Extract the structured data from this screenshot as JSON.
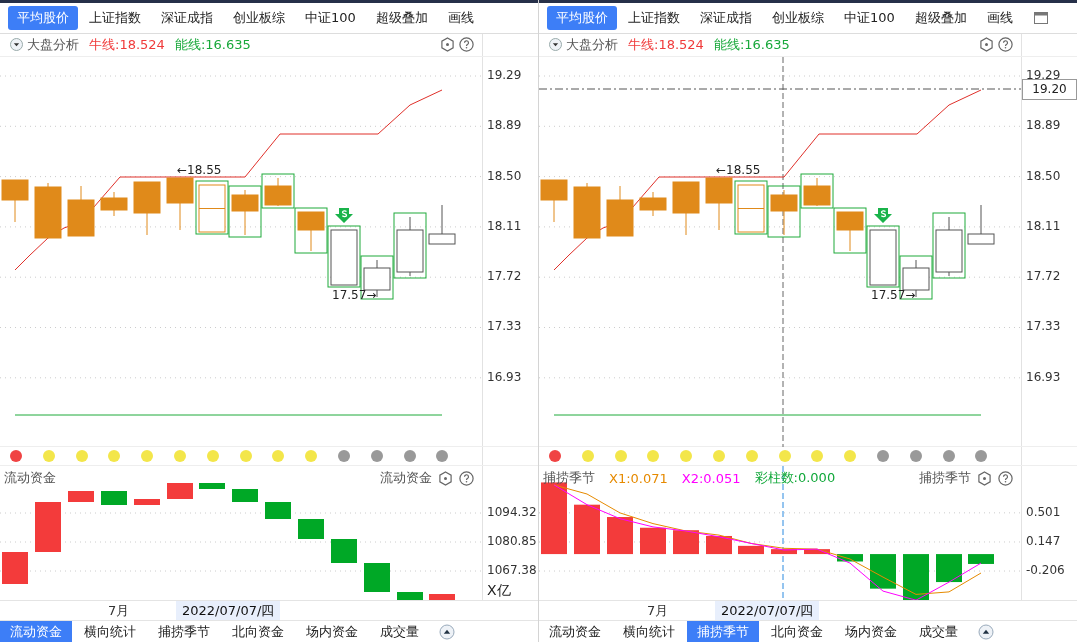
{
  "panels": [
    {
      "tabs": [
        {
          "label": "平均股价",
          "selected": true
        },
        {
          "label": "上证指数",
          "selected": false
        },
        {
          "label": "深证成指",
          "selected": false
        },
        {
          "label": "创业板综",
          "selected": false
        },
        {
          "label": "中证100",
          "selected": false
        },
        {
          "label": "超级叠加",
          "selected": false
        },
        {
          "label": "画线",
          "selected": false
        }
      ],
      "indicator": {
        "name": "大盘分析",
        "line_a": "牛线:18.524",
        "line_b": "能线:16.635"
      },
      "main_chart": {
        "yticks": [
          "19.29",
          "18.89",
          "18.50",
          "18.11",
          "17.72",
          "17.33",
          "16.93"
        ],
        "high_label": "←18.55",
        "low_label": "17.57→"
      },
      "dots": [
        {
          "color": "#f04343"
        },
        {
          "color": "#f3e64a"
        },
        {
          "color": "#f3e64a"
        },
        {
          "color": "#f3e64a"
        },
        {
          "color": "#f3e64a"
        },
        {
          "color": "#f3e64a"
        },
        {
          "color": "#f3e64a"
        },
        {
          "color": "#f3e64a"
        },
        {
          "color": "#f3e64a"
        },
        {
          "color": "#f3e64a"
        },
        {
          "color": "#999999"
        },
        {
          "color": "#999999"
        },
        {
          "color": "#999999"
        },
        {
          "color": "#999999"
        }
      ],
      "lower": {
        "kind": "waterfall",
        "title": "流动资金",
        "title_right": "流动资金",
        "yticks": [
          "1094.32",
          "1080.85",
          "1067.38"
        ],
        "unit": "X亿"
      },
      "date_row": {
        "month": "7月",
        "date": "2022/07/07/四"
      },
      "bottom_tabs": [
        {
          "label": "流动资金",
          "selected": true
        },
        {
          "label": "横向统计",
          "selected": false
        },
        {
          "label": "捕捞季节",
          "selected": false
        },
        {
          "label": "北向资金",
          "selected": false
        },
        {
          "label": "场内资金",
          "selected": false
        },
        {
          "label": "成交量",
          "selected": false
        }
      ]
    },
    {
      "tabs": [
        {
          "label": "平均股价",
          "selected": true
        },
        {
          "label": "上证指数",
          "selected": false
        },
        {
          "label": "深证成指",
          "selected": false
        },
        {
          "label": "创业板综",
          "selected": false
        },
        {
          "label": "中证100",
          "selected": false
        },
        {
          "label": "超级叠加",
          "selected": false
        },
        {
          "label": "画线",
          "selected": false
        }
      ],
      "maximize_button": true,
      "indicator": {
        "name": "大盘分析",
        "line_a": "牛线:18.524",
        "line_b": "能线:16.635"
      },
      "main_chart": {
        "yticks": [
          "19.29",
          "18.89",
          "18.50",
          "18.11",
          "17.72",
          "17.33",
          "16.93"
        ],
        "high_label": "←18.55",
        "low_label": "17.57→",
        "crosshair": {
          "price": "19.20"
        }
      },
      "dots": [
        {
          "color": "#f04343"
        },
        {
          "color": "#f3e64a"
        },
        {
          "color": "#f3e64a"
        },
        {
          "color": "#f3e64a"
        },
        {
          "color": "#f3e64a"
        },
        {
          "color": "#f3e64a"
        },
        {
          "color": "#f3e64a"
        },
        {
          "color": "#f3e64a"
        },
        {
          "color": "#f3e64a"
        },
        {
          "color": "#f3e64a"
        },
        {
          "color": "#999999"
        },
        {
          "color": "#999999"
        },
        {
          "color": "#999999"
        },
        {
          "color": "#999999"
        }
      ],
      "lower": {
        "kind": "bars",
        "title": "捕捞季节",
        "title_right": "捕捞季节",
        "legend": [
          {
            "text": "X1:0.071",
            "color": "#e68a00"
          },
          {
            "text": "X2:0.051",
            "color": "#ff00ff"
          },
          {
            "text": "彩柱数:0.000",
            "color": "#11a83a"
          }
        ],
        "chart_data": {
          "type": "bar",
          "grid": true,
          "ylim": [
            -0.57,
            1.07
          ],
          "yticks": [
            {
              "value": 0.501,
              "label": "0.501"
            },
            {
              "value": 0.147,
              "label": "0.147"
            },
            {
              "value": -0.206,
              "label": "-0.206"
            }
          ],
          "series": [
            {
              "type": "bar",
              "colors": [
                "#f33b3b",
                "#f33b3b",
                "#f33b3b",
                "#f33b3b",
                "#f33b3b",
                "#f33b3b",
                "#f33b3b",
                "#f33b3b",
                "#f33b3b",
                "#00a826",
                "#00a826",
                "#00a826",
                "#00a826",
                "#00a826"
              ],
              "values": [
                0.87,
                0.6,
                0.45,
                0.32,
                0.29,
                0.22,
                0.1,
                0.06,
                0.06,
                -0.09,
                -0.42,
                -0.56,
                -0.34,
                -0.12
              ]
            },
            {
              "type": "line",
              "color": "#e68a00",
              "values": [
                0.84,
                0.73,
                0.5,
                0.37,
                0.28,
                0.23,
                0.13,
                0.07,
                0.06,
                -0.06,
                -0.28,
                -0.49,
                -0.46,
                -0.23
              ]
            },
            {
              "type": "line",
              "color": "#ff00ff",
              "values": [
                0.84,
                0.6,
                0.43,
                0.33,
                0.28,
                0.21,
                0.13,
                0.05,
                0.06,
                -0.11,
                -0.45,
                -0.56,
                -0.34,
                -0.11
              ]
            }
          ]
        }
      },
      "date_row": {
        "month": "7月",
        "date": "2022/07/07/四"
      },
      "bottom_tabs": [
        {
          "label": "流动资金",
          "selected": false
        },
        {
          "label": "横向统计",
          "selected": false
        },
        {
          "label": "捕捞季节",
          "selected": true
        },
        {
          "label": "北向资金",
          "selected": false
        },
        {
          "label": "场内资金",
          "selected": false
        },
        {
          "label": "成交量",
          "selected": false
        }
      ]
    }
  ]
}
